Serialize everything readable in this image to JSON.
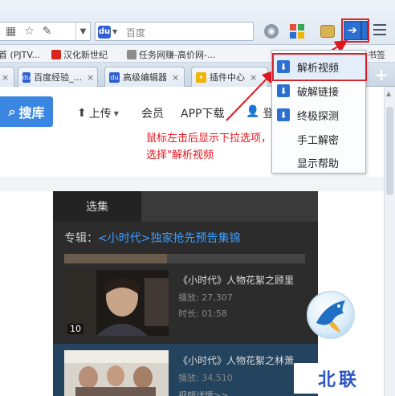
{
  "toolbar": {
    "search_placeholder": "百度",
    "search_engine_icon": "baidu-paw-icon",
    "icons": [
      "qr-code-icon",
      "star-icon",
      "pin-icon",
      "chevron-down-icon",
      "wifi-icon",
      "apps-icon",
      "box-icon",
      "extension-arrow-icon",
      "hamburger-menu-icon"
    ]
  },
  "bookmarks": [
    {
      "label": "首 (PJTV..."
    },
    {
      "label": "汉化新世纪"
    },
    {
      "label": "任务网赚-高价网-..."
    },
    {
      "label": "书签"
    }
  ],
  "tabs": [
    {
      "label": "百度经验_..."
    },
    {
      "label": "高级编辑器"
    },
    {
      "label": "插件中心"
    }
  ],
  "page": {
    "search_button": "搜库",
    "nav": {
      "upload": "上传",
      "member": "会员",
      "app_download": "APP下载",
      "login": "登"
    },
    "annotation": "鼠标左击后显示下拉选项，选择\"解析视频",
    "panel": {
      "tab": "选集",
      "album_prefix": "专辑：",
      "album_title": "<小时代>独家抢先预告集锦",
      "items": [
        {
          "title": "《小时代》人物花絮之顾里",
          "plays": "播放: 27,307",
          "duration": "时长: 01:58",
          "index": "10"
        },
        {
          "title": "《小时代》人物花絮之林萧",
          "plays": "播放: 34,510",
          "detail": "视频详情>>"
        }
      ]
    },
    "watermark": "北联"
  },
  "dropdown": {
    "items": [
      {
        "label": "解析视频",
        "icon": "download-arrow-icon",
        "selected": true
      },
      {
        "label": "破解链接",
        "icon": "download-arrow-icon"
      },
      {
        "label": "终极探测",
        "icon": "download-arrow-icon"
      },
      {
        "label": "手工解密"
      },
      {
        "label": "显示帮助"
      }
    ]
  },
  "colors": {
    "accent_blue": "#2b6fd0",
    "highlight_red": "#d8232a",
    "annotation_red": "#e0161e",
    "panel_dark": "#2c2c2c"
  }
}
